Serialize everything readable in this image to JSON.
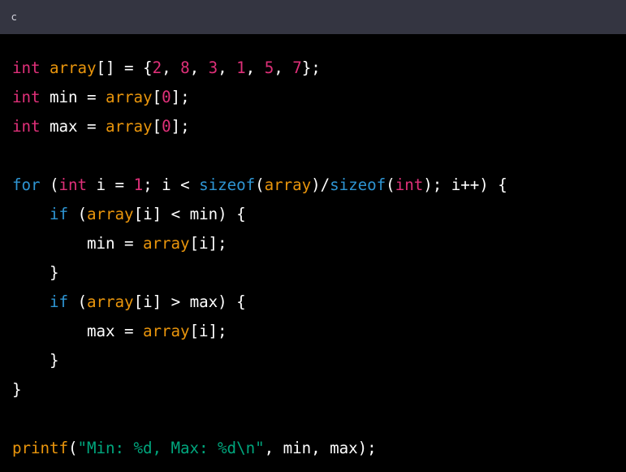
{
  "header": {
    "language": "c"
  },
  "colors": {
    "header_bg": "#343541",
    "code_bg": "#000000",
    "type": "#df3079",
    "function": "#e9950c",
    "number": "#df3079",
    "keyword": "#2e95d3",
    "string": "#00a67d",
    "plain": "#ffffff"
  },
  "code": {
    "lines": [
      [
        [
          "type",
          "int"
        ],
        [
          "plain",
          " "
        ],
        [
          "fn",
          "array"
        ],
        [
          "plain",
          "[] = {"
        ],
        [
          "num",
          "2"
        ],
        [
          "plain",
          ", "
        ],
        [
          "num",
          "8"
        ],
        [
          "plain",
          ", "
        ],
        [
          "num",
          "3"
        ],
        [
          "plain",
          ", "
        ],
        [
          "num",
          "1"
        ],
        [
          "plain",
          ", "
        ],
        [
          "num",
          "5"
        ],
        [
          "plain",
          ", "
        ],
        [
          "num",
          "7"
        ],
        [
          "plain",
          "};"
        ]
      ],
      [
        [
          "type",
          "int"
        ],
        [
          "plain",
          " min = "
        ],
        [
          "fn",
          "array"
        ],
        [
          "plain",
          "["
        ],
        [
          "num",
          "0"
        ],
        [
          "plain",
          "];"
        ]
      ],
      [
        [
          "type",
          "int"
        ],
        [
          "plain",
          " max = "
        ],
        [
          "fn",
          "array"
        ],
        [
          "plain",
          "["
        ],
        [
          "num",
          "0"
        ],
        [
          "plain",
          "];"
        ]
      ],
      [],
      [
        [
          "kw",
          "for"
        ],
        [
          "plain",
          " ("
        ],
        [
          "type",
          "int"
        ],
        [
          "plain",
          " i = "
        ],
        [
          "num",
          "1"
        ],
        [
          "plain",
          "; i < "
        ],
        [
          "kw",
          "sizeof"
        ],
        [
          "plain",
          "("
        ],
        [
          "fn",
          "array"
        ],
        [
          "plain",
          ")/"
        ],
        [
          "kw",
          "sizeof"
        ],
        [
          "plain",
          "("
        ],
        [
          "type",
          "int"
        ],
        [
          "plain",
          "); i++) {"
        ]
      ],
      [
        [
          "plain",
          "    "
        ],
        [
          "kw",
          "if"
        ],
        [
          "plain",
          " ("
        ],
        [
          "fn",
          "array"
        ],
        [
          "plain",
          "[i] < min) {"
        ]
      ],
      [
        [
          "plain",
          "        min = "
        ],
        [
          "fn",
          "array"
        ],
        [
          "plain",
          "[i];"
        ]
      ],
      [
        [
          "plain",
          "    }"
        ]
      ],
      [
        [
          "plain",
          "    "
        ],
        [
          "kw",
          "if"
        ],
        [
          "plain",
          " ("
        ],
        [
          "fn",
          "array"
        ],
        [
          "plain",
          "[i] > max) {"
        ]
      ],
      [
        [
          "plain",
          "        max = "
        ],
        [
          "fn",
          "array"
        ],
        [
          "plain",
          "[i];"
        ]
      ],
      [
        [
          "plain",
          "    }"
        ]
      ],
      [
        [
          "plain",
          "}"
        ]
      ],
      [],
      [
        [
          "fn",
          "printf"
        ],
        [
          "plain",
          "("
        ],
        [
          "str",
          "\"Min: %d, Max: %d\\n\""
        ],
        [
          "plain",
          ", min, max);"
        ]
      ]
    ]
  }
}
